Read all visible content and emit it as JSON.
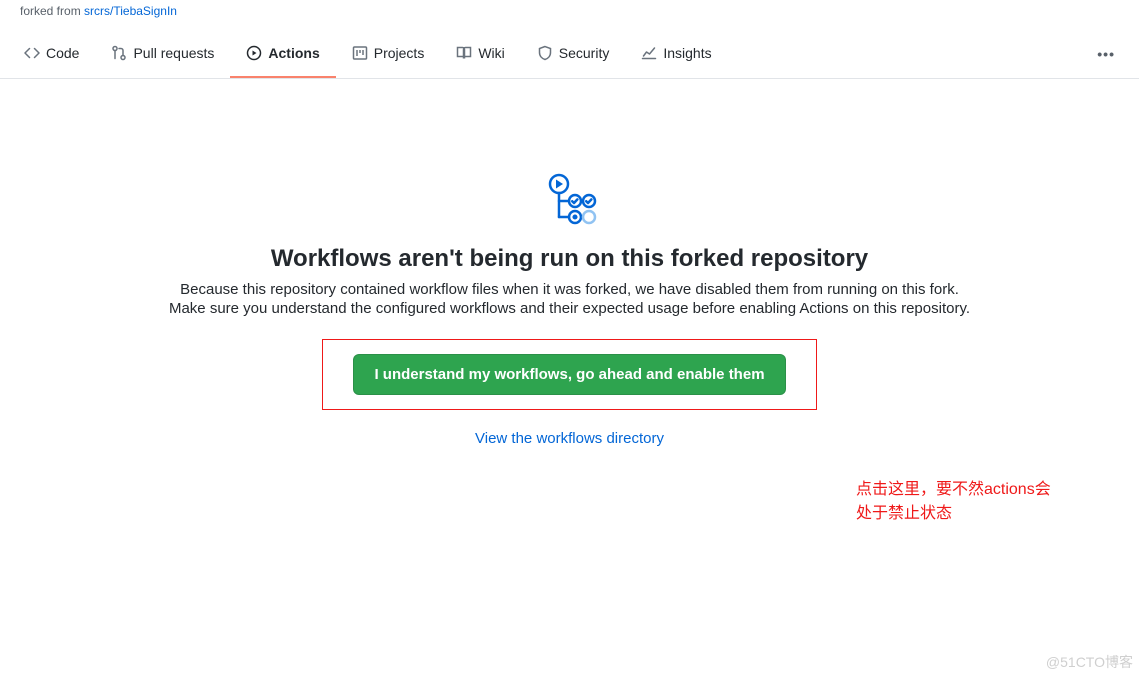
{
  "fork": {
    "prefix": "forked from ",
    "repo": "srcrs/TiebaSignIn"
  },
  "nav": {
    "code": "Code",
    "pulls": "Pull requests",
    "actions": "Actions",
    "projects": "Projects",
    "wiki": "Wiki",
    "security": "Security",
    "insights": "Insights"
  },
  "blankslate": {
    "title": "Workflows aren't being run on this forked repository",
    "desc1": "Because this repository contained workflow files when it was forked, we have disabled them from running on this fork.",
    "desc2": "Make sure you understand the configured workflows and their expected usage before enabling Actions on this repository.",
    "enable_button": "I understand my workflows, go ahead and enable them",
    "view_link": "View the workflows directory"
  },
  "annotation": {
    "line1": "点击这里，要不然actions会",
    "line2": "处于禁止状态"
  },
  "watermark": "@51CTO博客"
}
